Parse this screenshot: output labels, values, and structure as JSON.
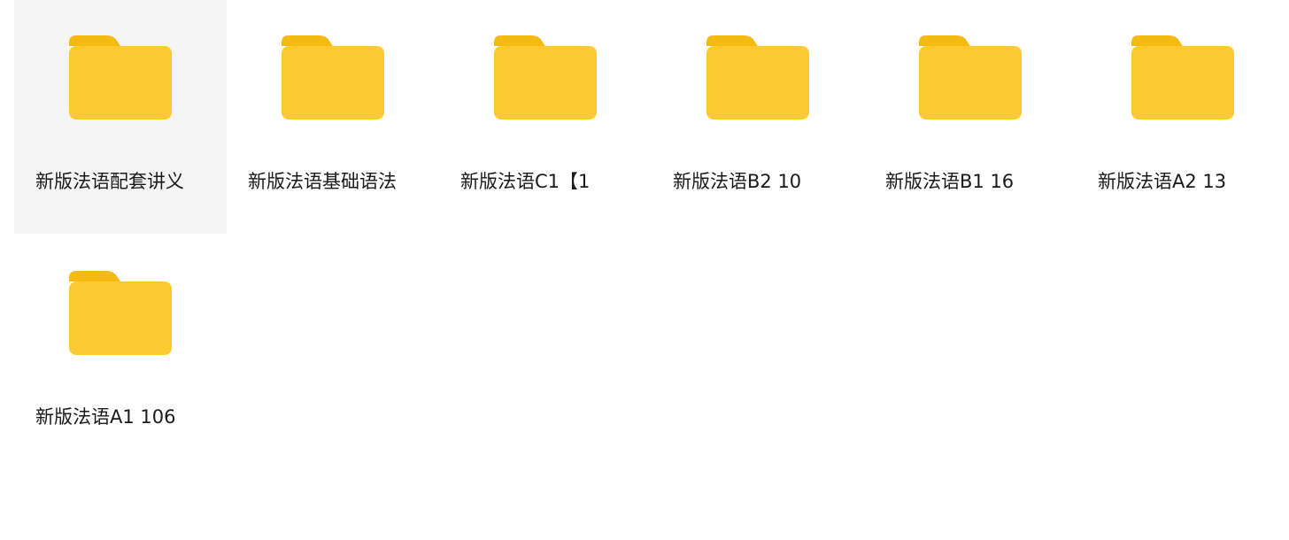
{
  "folders": [
    {
      "label": "新版法语配套讲义",
      "selected": true
    },
    {
      "label": "新版法语基础语法",
      "selected": false
    },
    {
      "label": "新版法语C1【1",
      "selected": false
    },
    {
      "label": "新版法语B2 10",
      "selected": false
    },
    {
      "label": "新版法语B1 16",
      "selected": false
    },
    {
      "label": "新版法语A2 13",
      "selected": false
    },
    {
      "label": "新版法语A1 106",
      "selected": false
    }
  ],
  "icon": "folder-icon",
  "colors": {
    "folder_body": "#fdca32",
    "folder_tab": "#f5b913",
    "selected_bg": "#f5f5f5"
  }
}
